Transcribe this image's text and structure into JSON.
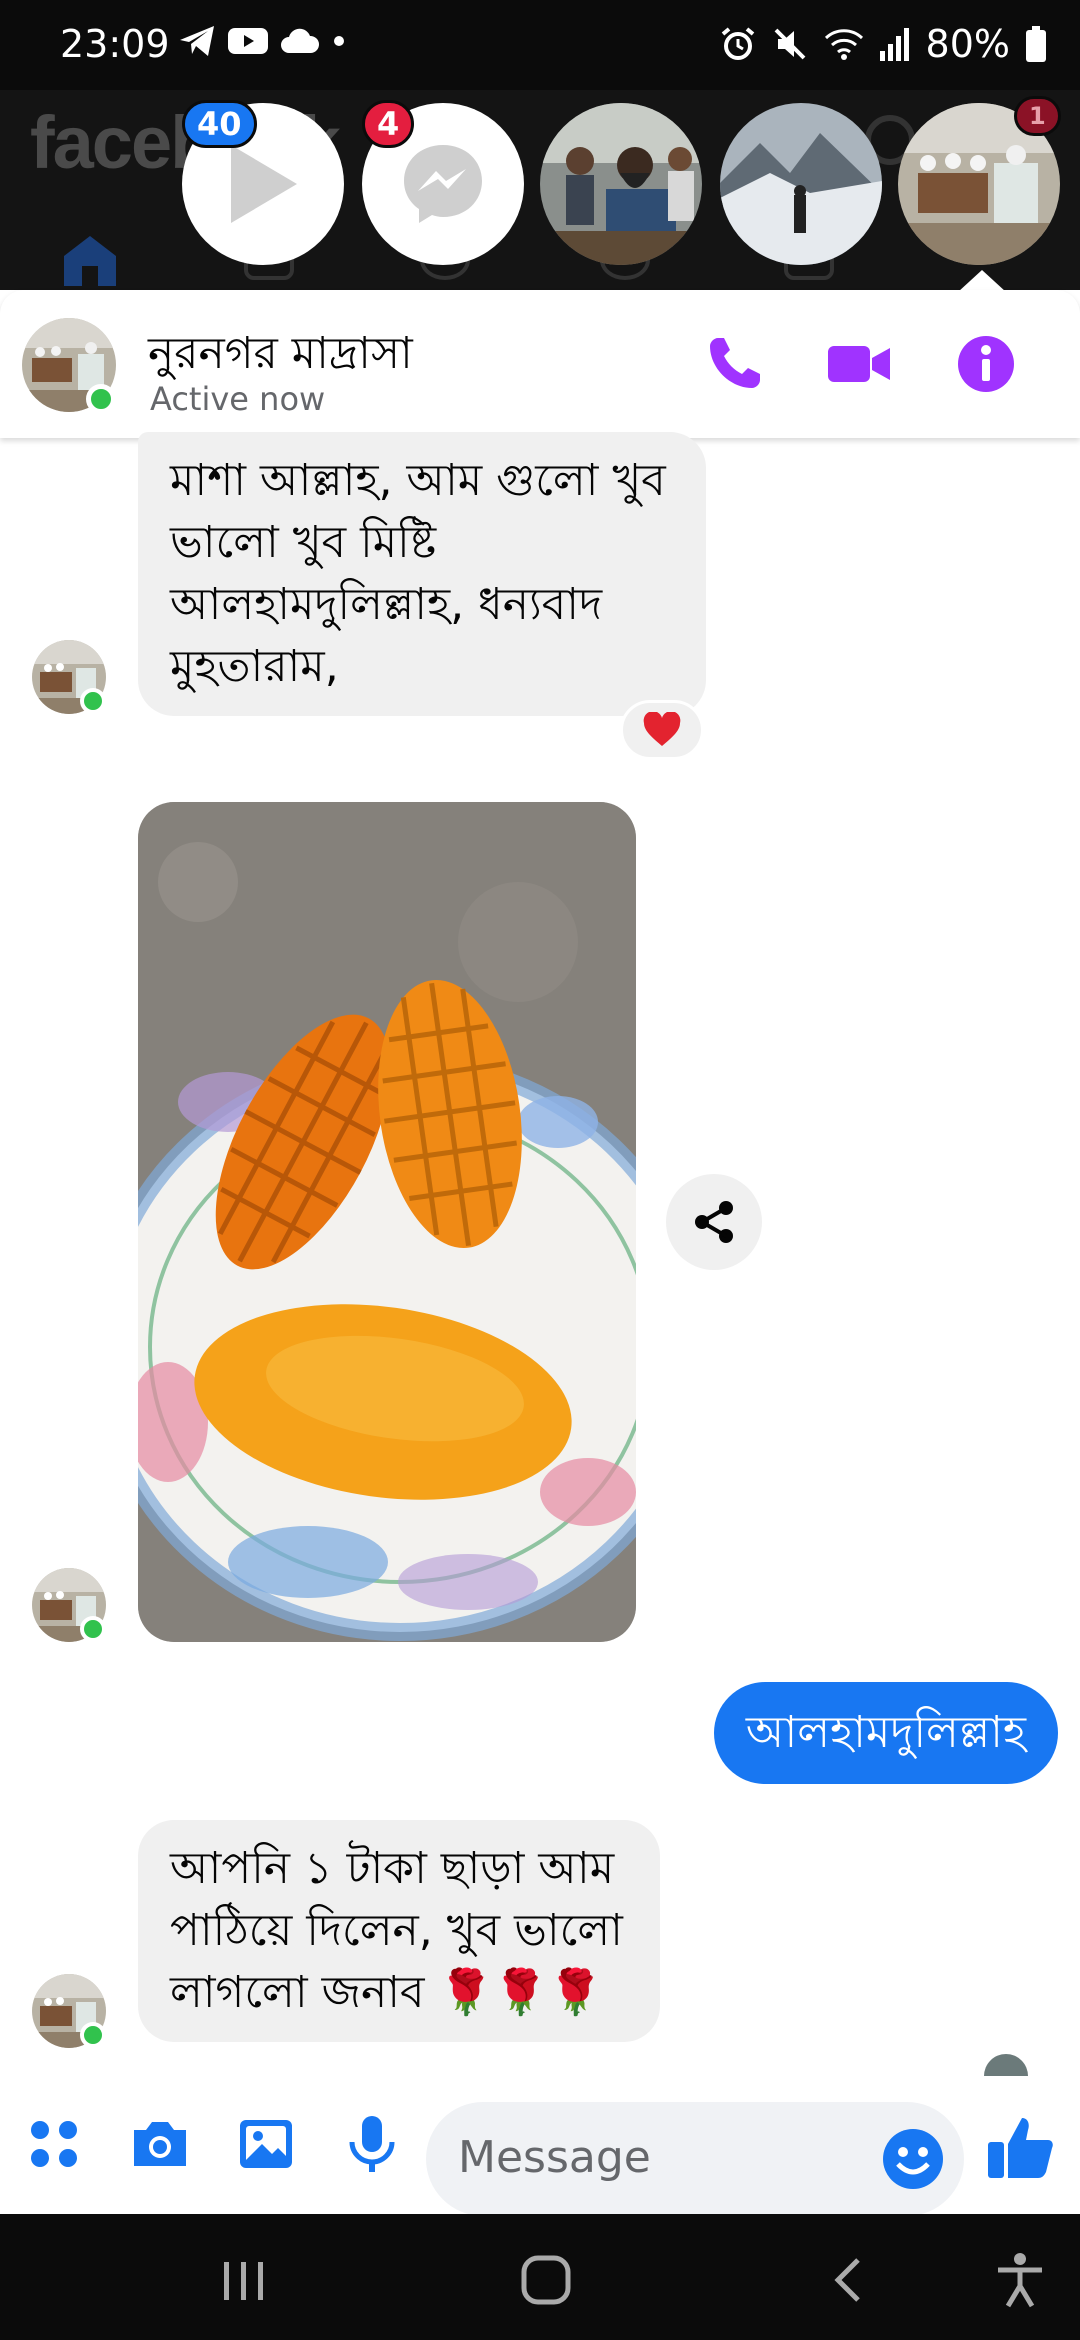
{
  "status_bar": {
    "time": "23:09",
    "battery": "80%"
  },
  "background_app": {
    "logo_text": "facebook"
  },
  "chat_heads": {
    "video_badge": "40",
    "messenger_badge": "4",
    "last_badge": "1"
  },
  "conversation": {
    "name": "নুরনগর মাদ্রাসা",
    "status": "Active now"
  },
  "messages": [
    {
      "sender": "them",
      "lines": [
        "মাশা আল্লাহ, আম গুলো খুব",
        "ভালো খুব মিষ্টি",
        "আলহামদুলিল্লাহ, ধন্যবাদ",
        "মুহতারাম,"
      ],
      "reaction": "❤️"
    },
    {
      "sender": "them",
      "type": "photo"
    },
    {
      "sender": "me",
      "text": "আলহামদুলিল্লাহ"
    },
    {
      "sender": "them",
      "lines": [
        "আপনি ১ টাকা ছাড়া আম",
        "পাঠিয়ে দিলেন, খুব ভালো",
        "লাগলো জনাব 🌹🌹🌹"
      ]
    }
  ],
  "composer": {
    "placeholder": "Message"
  },
  "colors": {
    "messenger_purple": "#a033ff",
    "messenger_blue": "#1877f2",
    "online_green": "#31c24d",
    "badge_red": "#e41e3f"
  }
}
